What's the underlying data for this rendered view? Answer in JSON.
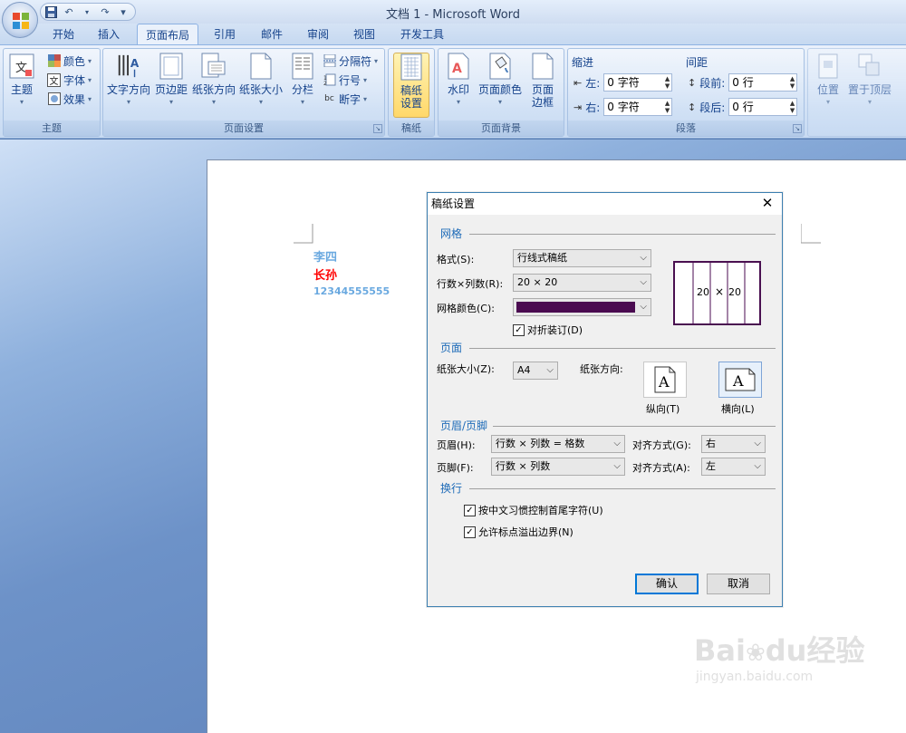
{
  "window": {
    "title": "文档 1 - Microsoft Word"
  },
  "qat": {
    "save_icon": "save-icon",
    "undo_icon": "undo-icon",
    "redo_icon": "redo-icon",
    "more": "▾"
  },
  "tabs": [
    {
      "label": "开始"
    },
    {
      "label": "插入"
    },
    {
      "label": "页面布局",
      "active": true
    },
    {
      "label": "引用"
    },
    {
      "label": "邮件"
    },
    {
      "label": "审阅"
    },
    {
      "label": "视图"
    },
    {
      "label": "开发工具"
    }
  ],
  "ribbon": {
    "theme": {
      "label": "主题",
      "themes": "主题",
      "colors": "颜色",
      "fonts": "字体",
      "effects": "效果"
    },
    "page_setup": {
      "label": "页面设置",
      "text_direction": "文字方向",
      "margins": "页边距",
      "orientation": "纸张方向",
      "size": "纸张大小",
      "columns": "分栏",
      "breaks": "分隔符",
      "line_numbers": "行号",
      "hyphenation": "断字"
    },
    "gaozhi": {
      "label": "稿纸",
      "button": "稿纸\n设置",
      "line1": "稿纸",
      "line2": "设置"
    },
    "background": {
      "label": "页面背景",
      "watermark": "水印",
      "page_color": "页面颜色",
      "page_borders_1": "页面",
      "page_borders_2": "边框"
    },
    "paragraph": {
      "label": "段落",
      "indent": "缩进",
      "left": "左:",
      "left_value": "0 字符",
      "right": "右:",
      "right_value": "0 字符",
      "spacing": "间距",
      "before": "段前:",
      "before_value": "0 行",
      "after": "段后:",
      "after_value": "0 行"
    },
    "arrange": {
      "position": "位置",
      "bring_front": "置于顶层",
      "send_back": "置"
    }
  },
  "document": {
    "line1": "李四",
    "line1_color": "#6aa9e0",
    "line2": "长孙",
    "line2_color": "#ff0000",
    "line3": "12344555555",
    "line3_color": "#6aa9e0"
  },
  "dialog": {
    "title": "稿纸设置",
    "grid_section": "网格",
    "style_label": "格式(S):",
    "style_value": "行线式稿纸",
    "rows_cols_label": "行数×列数(R):",
    "rows_cols_value": "20 × 20",
    "grid_color_label": "网格颜色(C):",
    "grid_color": "#4a0a50",
    "fold_label": "对折装订(D)",
    "fold_checked": true,
    "preview_text_a": "20",
    "preview_text_x": "×",
    "preview_text_b": "20",
    "page_section": "页面",
    "paper_size_label": "纸张大小(Z):",
    "paper_size_value": "A4",
    "orientation_label": "纸张方向:",
    "portrait_label": "纵向(T)",
    "landscape_label": "横向(L)",
    "header_footer_section": "页眉/页脚",
    "header_label": "页眉(H):",
    "header_value": "行数 × 列数 = 格数",
    "header_align_label": "对齐方式(G):",
    "header_align_value": "右",
    "footer_label": "页脚(F):",
    "footer_value": "行数 × 列数",
    "footer_align_label": "对齐方式(A):",
    "footer_align_value": "左",
    "wrap_section": "换行",
    "chk1_label": "按中文习惯控制首尾字符(U)",
    "chk1_checked": true,
    "chk2_label": "允许标点溢出边界(N)",
    "chk2_checked": true,
    "ok": "确认",
    "cancel": "取消"
  },
  "watermark": {
    "text1": "Bai",
    "text2": "du",
    "text3": "经验",
    "url": "jingyan.baidu.com"
  }
}
